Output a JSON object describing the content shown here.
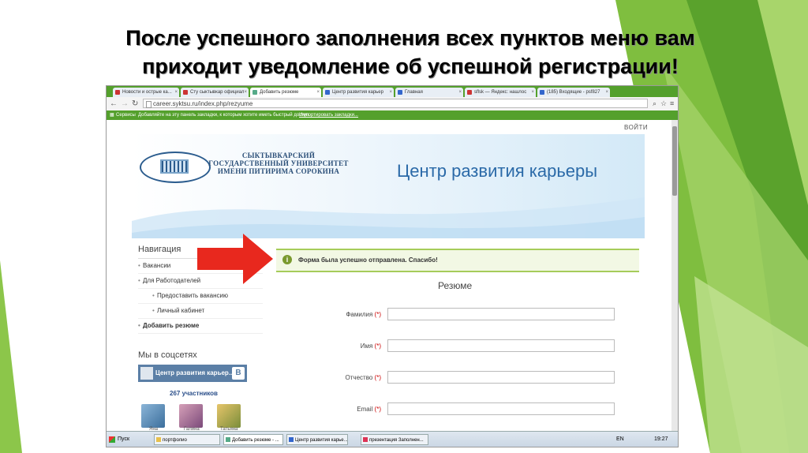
{
  "slide": {
    "title_line1": "После успешного заполнения всех пунктов меню вам",
    "title_line2": "приходит уведомление об успешной регистрации!"
  },
  "colors": {
    "accent_green": "#54a02c",
    "arrow_red": "#e8281e",
    "title_blue": "#2b6aa8"
  },
  "browser": {
    "tabs": [
      {
        "label": "Новости и острые ка..."
      },
      {
        "label": "Сту сыктывкар официал"
      },
      {
        "label": "Добавить резюме"
      },
      {
        "label": "Центр развития карьер"
      },
      {
        "label": "Главная"
      },
      {
        "label": "sflsk — Яндекс: нашлос"
      },
      {
        "label": "(185) Входящие - psf827"
      }
    ],
    "url": "career.syktsu.ru/index.php/rezyume",
    "bookmarks": {
      "services": "Сервисы",
      "hint": "Добавляйте на эту панель закладки, к которым хотите иметь быстрый доступ.",
      "import": "Импортировать закладки..."
    }
  },
  "site": {
    "login": "ВОЙТИ",
    "university_line1": "СЫКТЫВКАРСКИЙ",
    "university_line2": "ГОСУДАРСТВЕННЫЙ УНИВЕРСИТЕТ",
    "university_line3": "ИМЕНИ ПИТИРИМА СОРОКИНА",
    "center_title": "Центр развития карьеры",
    "nav": {
      "heading": "Навигация",
      "items": [
        {
          "label": "Вакансии"
        },
        {
          "label": "Для Работодателей"
        },
        {
          "label": "Предоставить вакансию"
        },
        {
          "label": "Личный кабинет"
        },
        {
          "label": "Добавить резюме"
        }
      ]
    },
    "social": {
      "heading": "Мы в соцсетях",
      "group": "Центр развития карьер...",
      "vk_logo": "B",
      "members": "267 участников",
      "avatars": [
        {
          "name": "Яна"
        },
        {
          "name": "Галина"
        },
        {
          "name": "Татьяна"
        }
      ]
    },
    "success": {
      "icon": "i",
      "message": "Форма была успешно отправлена. Спасибо!"
    },
    "form": {
      "title": "Резюме",
      "fields": [
        {
          "label": "Фамилия",
          "req": "(*)"
        },
        {
          "label": "Имя",
          "req": "(*)"
        },
        {
          "label": "Отчество",
          "req": "(*)"
        },
        {
          "label": "Email",
          "req": "(*)"
        }
      ]
    }
  },
  "taskbar": {
    "start": "Пуск",
    "buttons": [
      {
        "label": "портфолио"
      },
      {
        "label": "Добавить резюме - ..."
      },
      {
        "label": "Центр развития карье..."
      },
      {
        "label": "презентация Заполнен..."
      }
    ],
    "lang": "EN",
    "clock": "19:27"
  }
}
